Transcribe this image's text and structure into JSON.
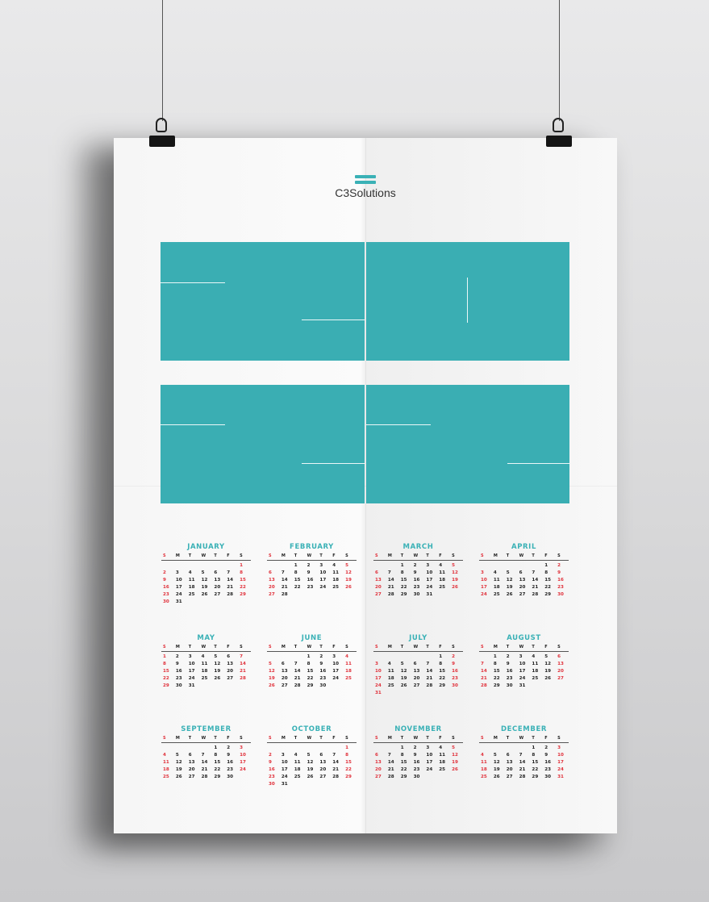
{
  "brand": {
    "name": "C3Solutions",
    "color": "#3ab1b6"
  },
  "colors": {
    "accent": "#3ab1b6",
    "weekend": "#e0303a",
    "text": "#222222"
  },
  "weekday_headers": [
    "S",
    "M",
    "T",
    "W",
    "T",
    "F",
    "S"
  ],
  "months": [
    {
      "name": "JANUARY",
      "start": 6,
      "days": 31
    },
    {
      "name": "FEBRUARY",
      "start": 2,
      "days": 28
    },
    {
      "name": "MARCH",
      "start": 2,
      "days": 31
    },
    {
      "name": "APRIL",
      "start": 5,
      "days": 30
    },
    {
      "name": "MAY",
      "start": 0,
      "days": 31
    },
    {
      "name": "JUNE",
      "start": 3,
      "days": 30
    },
    {
      "name": "JULY",
      "start": 5,
      "days": 31
    },
    {
      "name": "AUGUST",
      "start": 1,
      "days": 31
    },
    {
      "name": "SEPTEMBER",
      "start": 4,
      "days": 30
    },
    {
      "name": "OCTOBER",
      "start": 6,
      "days": 31
    },
    {
      "name": "NOVEMBER",
      "start": 2,
      "days": 30
    },
    {
      "name": "DECEMBER",
      "start": 4,
      "days": 31
    }
  ]
}
